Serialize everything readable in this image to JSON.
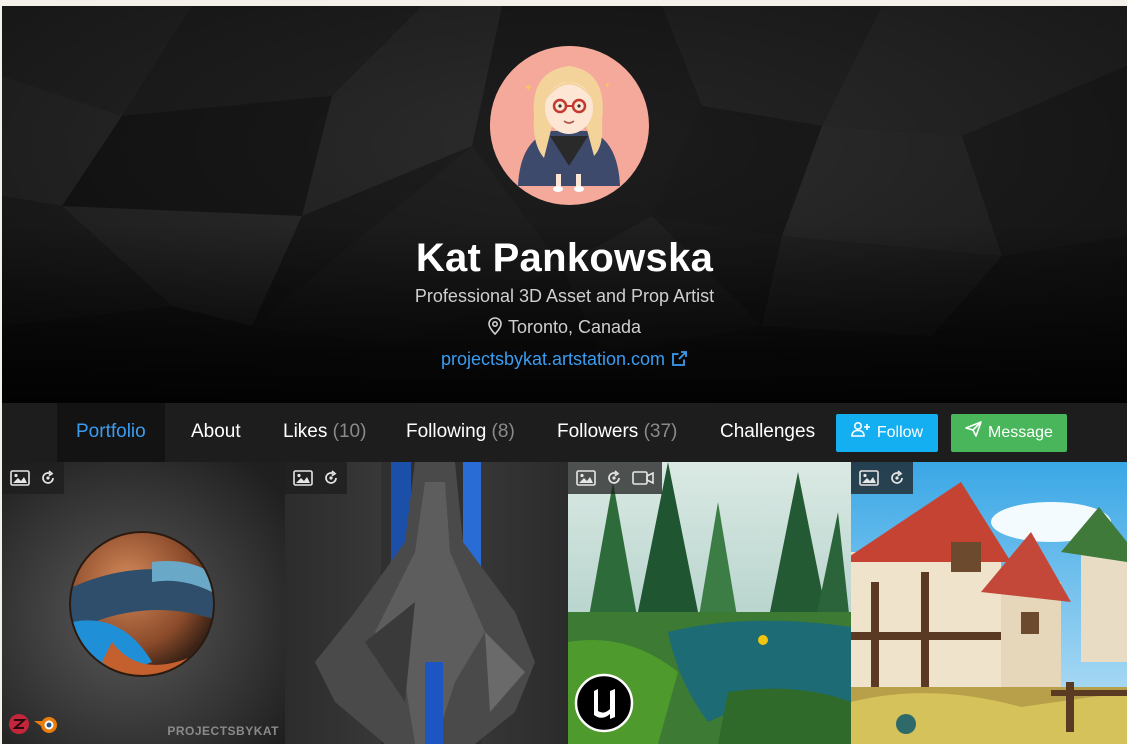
{
  "profile": {
    "name": "Kat Pankowska",
    "headline": "Professional 3D Asset and Prop Artist",
    "location": "Toronto, Canada",
    "website": "projectsbykat.artstation.com"
  },
  "nav": {
    "tabs": [
      {
        "label": "Portfolio",
        "count": "",
        "active": true
      },
      {
        "label": "About",
        "count": ""
      },
      {
        "label": "Likes",
        "count": "(10)"
      },
      {
        "label": "Following",
        "count": "(8)"
      },
      {
        "label": "Followers",
        "count": "(37)"
      },
      {
        "label": "Challenges",
        "count": ""
      }
    ],
    "follow_label": "Follow",
    "message_label": "Message"
  },
  "portfolio": {
    "tiles": [
      {
        "badges": [
          "image-icon",
          "rotate-3d-icon"
        ],
        "watermark": "PROJECTSBYKAT",
        "tools": [
          "zbrush-icon",
          "blender-icon"
        ]
      },
      {
        "badges": [
          "image-icon",
          "rotate-3d-icon"
        ]
      },
      {
        "badges": [
          "image-icon",
          "rotate-3d-icon",
          "video-icon"
        ],
        "tools": [
          "unreal-engine-icon"
        ]
      },
      {
        "badges": [
          "image-icon",
          "rotate-3d-icon"
        ]
      }
    ]
  },
  "colors": {
    "accent": "#3b9cf0",
    "follow": "#13aff0",
    "message": "#49b65b",
    "nav_bg": "#1d1d1d"
  }
}
